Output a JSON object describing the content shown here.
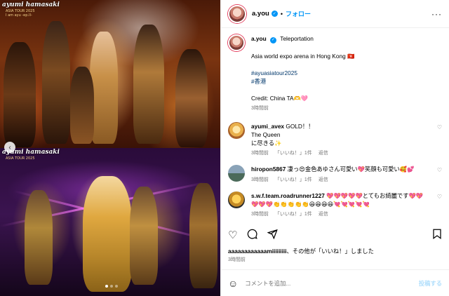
{
  "media": {
    "logo_title": "ayumi hamasaki",
    "logo_tour": "ASIA TOUR 2025",
    "logo_sub": "I am ayu -ep.II-",
    "carousel": {
      "index": 1,
      "count": 3
    }
  },
  "header": {
    "username": "a.you",
    "separator": "•",
    "follow_label": "フォロー",
    "more_label": "···"
  },
  "caption": {
    "username": "a.you",
    "title": "Teleportation",
    "line1": "Asia world expo arena in Hong Kong 🇭🇰",
    "hashtag1": "#ayuasiatour2025",
    "hashtag2": "#香港",
    "credit": "Credit: China TA🫶🩷",
    "time": "3時間前"
  },
  "comments": [
    {
      "username": "ayumi_avex",
      "text_lines": [
        "GOLD！！",
        "The Queen",
        "に尽きる✨"
      ],
      "time": "3時間前",
      "likes": "「いいね！」1件",
      "reply": "返信"
    },
    {
      "username": "hiropon5867",
      "text_lines": [
        "凄っ😍金色あゆさん可愛い💖笑顔も可愛い🥰💕"
      ],
      "time": "3時間前",
      "likes": "「いいね！」1件",
      "reply": "返信"
    },
    {
      "username": "s.w.f.team.roadrunner1227",
      "text_lines": [
        "💖💖💖💖💖とてもお綺麗です💖💖",
        "💖💖💖👏👏👏👏👏😆😆😆😆💘💘💘💘💘"
      ],
      "time": "3時間前",
      "likes": "「いいね！」1件",
      "reply": "返信"
    }
  ],
  "likes_text": {
    "user": "aaaaaaaaaaaamiiiiiiiii",
    "rest": "、その他が「いいね！」しました"
  },
  "post_time": "3時間前",
  "composer": {
    "placeholder": "コメントを追加...",
    "post_label": "投稿する"
  },
  "icons": {
    "like": "heart-outline-icon",
    "comment": "speech-bubble-icon",
    "share": "paper-plane-icon",
    "save": "bookmark-icon",
    "emoji": "smiley-icon",
    "verified": "verified-badge-icon"
  },
  "colors": {
    "accent": "#0095f6",
    "link": "#00376b",
    "muted": "#737373"
  }
}
